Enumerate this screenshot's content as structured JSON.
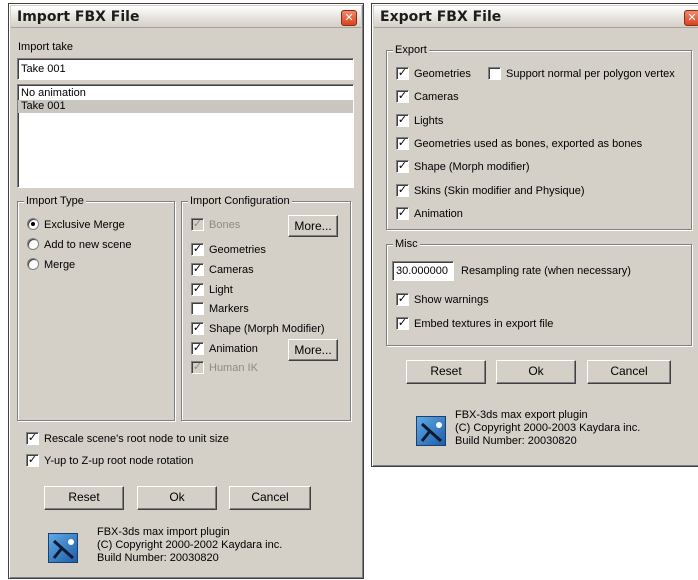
{
  "import_dialog": {
    "title": "Import FBX File",
    "close_glyph": "✕",
    "take_label": "Import take",
    "take_value": "Take 001",
    "take_list": [
      "No animation",
      "Take 001"
    ],
    "type_group": {
      "title": "Import Type",
      "options": [
        {
          "label": "Exclusive Merge",
          "selected": true
        },
        {
          "label": "Add to new scene",
          "selected": false
        },
        {
          "label": "Merge",
          "selected": false
        }
      ]
    },
    "config_group": {
      "title": "Import Configuration",
      "bones": "Bones",
      "bones_more": "More...",
      "geometries": "Geometries",
      "cameras": "Cameras",
      "light": "Light",
      "markers": "Markers",
      "shape": "Shape (Morph Modifier)",
      "animation": "Animation",
      "animation_more": "More...",
      "human_ik": "Human IK"
    },
    "rescale": "Rescale scene's root node to unit size",
    "yup": "Y-up to Z-up root node rotation",
    "buttons": {
      "reset": "Reset",
      "ok": "Ok",
      "cancel": "Cancel"
    },
    "about": [
      "FBX-3ds max import plugin",
      "(C) Copyright 2000-2002 Kaydara inc.",
      "Build Number: 20030820"
    ]
  },
  "export_dialog": {
    "title": "Export FBX File",
    "close_glyph": "✕",
    "export_group": {
      "title": "Export",
      "geometries": "Geometries",
      "normal_per_poly": "Support normal per polygon vertex",
      "cameras": "Cameras",
      "lights": "Lights",
      "bones": "Geometries used as bones, exported as bones",
      "shape": "Shape (Morph modifier)",
      "skins": "Skins (Skin modifier and Physique)",
      "animation": "Animation"
    },
    "misc_group": {
      "title": "Misc",
      "resample_value": "30.000000",
      "resample_label": "Resampling rate (when necessary)",
      "show_warnings": "Show warnings",
      "embed_textures": "Embed textures in export file"
    },
    "buttons": {
      "reset": "Reset",
      "ok": "Ok",
      "cancel": "Cancel"
    },
    "about": [
      "FBX-3ds max export plugin",
      "(C) Copyright 2000-2003 Kaydara inc.",
      "Build Number: 20030820"
    ]
  },
  "colors": {
    "dialog_bg": "#d4d0c8",
    "selection": "#c9c6c0",
    "close_button": "#d9431f",
    "logo": "#2f7dd0"
  },
  "icons": {
    "close": "close-icon",
    "logo": "fbx-logo-icon",
    "check": "checkmark-icon",
    "radio": "radio-dot-icon"
  }
}
